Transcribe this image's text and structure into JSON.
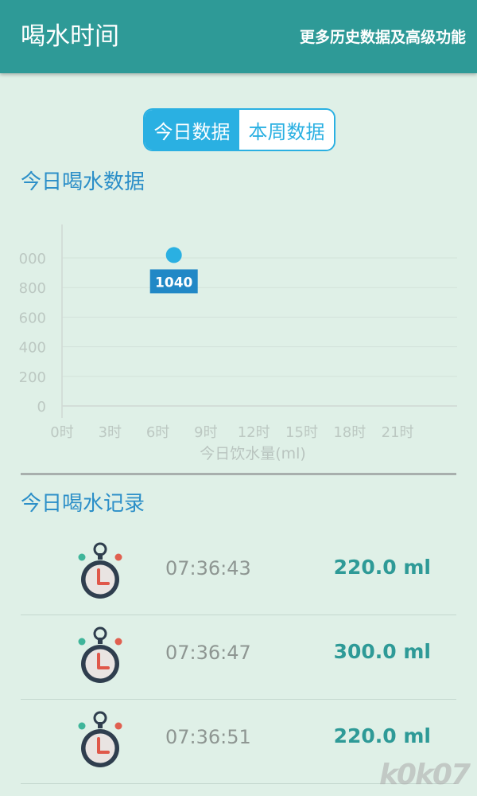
{
  "header": {
    "title": "喝水时间",
    "more_link": "更多历史数据及高级功能"
  },
  "tabs": [
    {
      "label": "今日数据",
      "active": true
    },
    {
      "label": "本周数据",
      "active": false
    }
  ],
  "chart_section": {
    "title": "今日喝水数据"
  },
  "chart_data": {
    "type": "scatter",
    "xlabel": "今日饮水量(ml)",
    "ylabel": "",
    "x_ticks": [
      "0时",
      "3时",
      "6时",
      "9时",
      "12时",
      "15时",
      "18时",
      "21时"
    ],
    "y_ticks": [
      "0",
      "200",
      "400",
      "600",
      "800",
      "000"
    ],
    "xlim": [
      0,
      24
    ],
    "ylim": [
      0,
      1000
    ],
    "points": [
      {
        "x": 7,
        "y": 1040,
        "label": "1040"
      }
    ],
    "colors": {
      "point": "#2ab0e2",
      "label_bg": "#2188c6"
    }
  },
  "records_section": {
    "title": "今日喝水记录",
    "records": [
      {
        "time": "07:36:43",
        "amount": "220.0 ml"
      },
      {
        "time": "07:36:47",
        "amount": "300.0 ml"
      },
      {
        "time": "07:36:51",
        "amount": "220.0 ml"
      }
    ]
  },
  "watermark": "k0k07",
  "colors": {
    "appbar": "#2e9a97",
    "background": "#dff0e7",
    "accent": "#2ab0e2",
    "amount": "#2e9a97"
  }
}
